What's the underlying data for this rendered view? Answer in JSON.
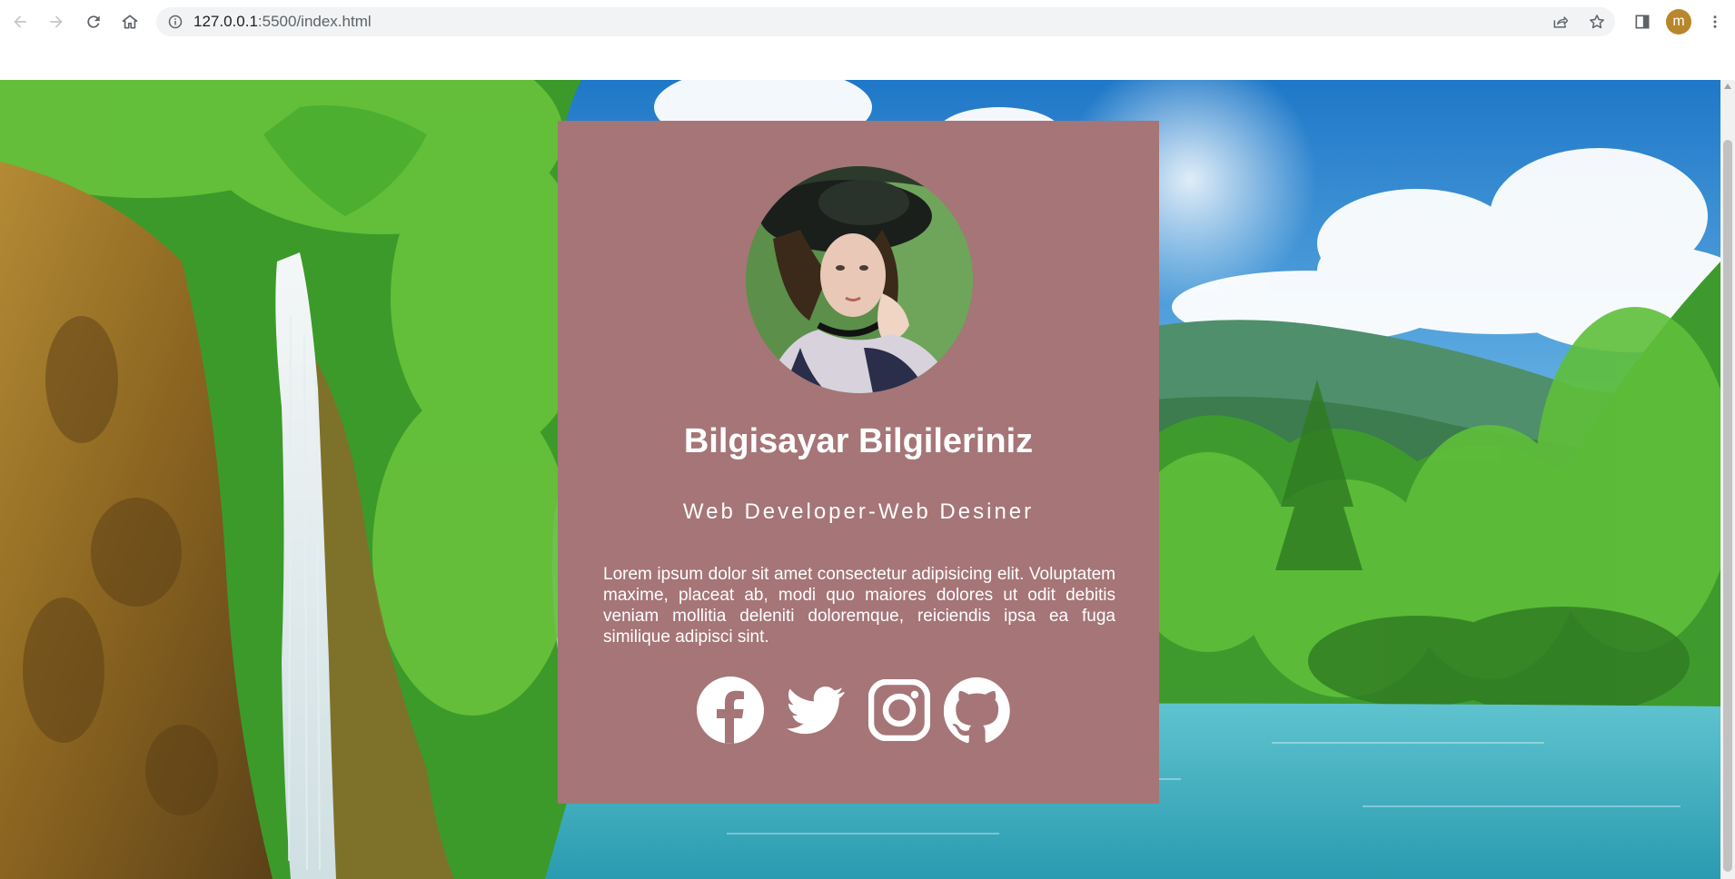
{
  "browser": {
    "url_host": "127.0.0.1",
    "url_rest": ":5500/index.html",
    "avatar_letter": "m",
    "back_icon": "arrow-left-icon",
    "forward_icon": "arrow-right-icon",
    "reload_icon": "reload-icon",
    "home_icon": "home-icon",
    "info_icon": "info-icon",
    "share_icon": "share-icon",
    "bookmark_icon": "star-icon",
    "sidepanel_icon": "side-panel-icon",
    "menu_icon": "kebab-menu-icon"
  },
  "card": {
    "title": "Bilgisayar Bilgileriniz",
    "subtitle": "Web Developer-Web Desiner",
    "text": "Lorem ipsum dolor sit amet consectetur adipisicing elit. Voluptatem maxime, placeat ab, modi quo maiores dolores ut odit debitis veniam mollitia deleniti doloremque, reiciendis ipsa ea fuga similique adipisci sint.",
    "socials": [
      {
        "icon": "facebook-icon"
      },
      {
        "icon": "twitter-icon"
      },
      {
        "icon": "instagram-icon"
      },
      {
        "icon": "github-icon"
      }
    ]
  },
  "colors": {
    "card_background": "#a67577",
    "card_text": "#ffffff",
    "avatar_background": "#b8862b",
    "omnibox_background": "#f1f3f4"
  }
}
